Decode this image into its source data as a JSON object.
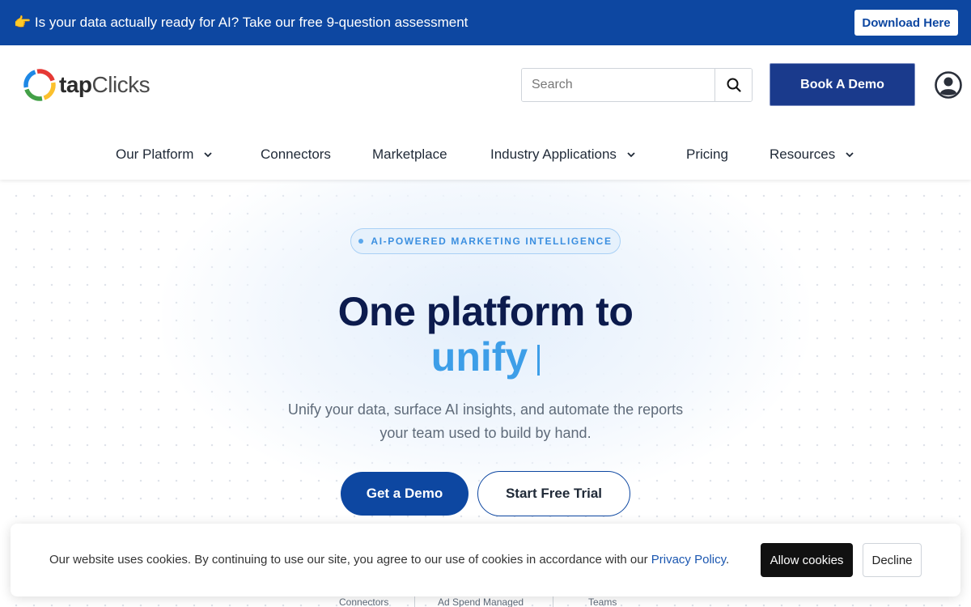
{
  "announcement": {
    "emoji": "👉",
    "text": "Is your data actually ready for AI? Take our free 9-question assessment",
    "button_label": "Download Here"
  },
  "header": {
    "logo": {
      "part1": "tap",
      "part2": "Clicks",
      "icon": "tapclicks-ring-logo"
    },
    "search": {
      "placeholder": "Search",
      "icon": "search-icon"
    },
    "book_demo_label": "Book A Demo",
    "user_icon": "user-account-icon"
  },
  "nav": {
    "items": [
      {
        "label": "Our Platform",
        "has_dropdown": true
      },
      {
        "label": "Connectors",
        "has_dropdown": false
      },
      {
        "label": "Marketplace",
        "has_dropdown": false
      },
      {
        "label": "Industry Applications",
        "has_dropdown": true
      },
      {
        "label": "Pricing",
        "has_dropdown": false
      },
      {
        "label": "Resources",
        "has_dropdown": true
      }
    ]
  },
  "hero": {
    "badge": "AI-POWERED MARKETING INTELLIGENCE",
    "headline": "One platform to",
    "rotating_word": "unify",
    "subtext": "Unify your data, surface AI insights, and automate the reports your team used to build by hand.",
    "cta_primary": "Get a Demo",
    "cta_secondary": "Start Free Trial",
    "stats": [
      {
        "label": "Connectors"
      },
      {
        "label": "Ad Spend Managed"
      },
      {
        "label": "Teams"
      }
    ]
  },
  "cookie_banner": {
    "text": "Our website uses cookies. By continuing to use our site, you agree to our use of cookies in accordance with our",
    "link_label": "Privacy Policy",
    "after_link": ".",
    "allow_label": "Allow cookies",
    "decline_label": "Decline"
  },
  "colors": {
    "announcement_bg": "#0d47a1",
    "primary_navy": "#1a3a8c",
    "headline": "#0c1b4d",
    "accent_blue": "#3d9ee8",
    "cookie_allow_bg": "#111111"
  }
}
